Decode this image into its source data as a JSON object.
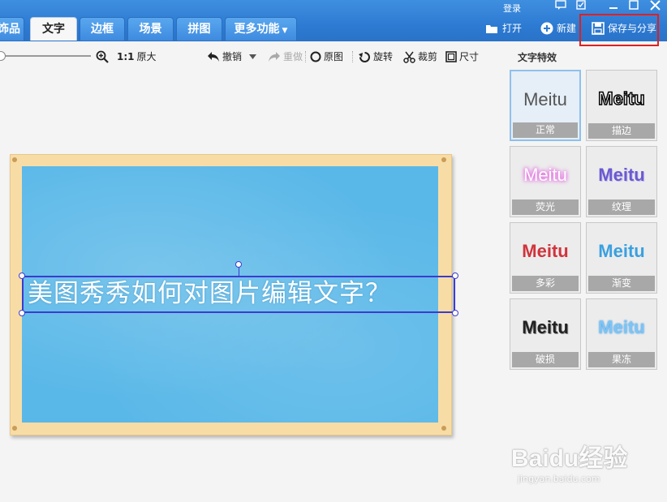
{
  "header": {
    "tabs": [
      {
        "label": "饰品"
      },
      {
        "label": "文字"
      },
      {
        "label": "边框"
      },
      {
        "label": "场景"
      },
      {
        "label": "拼图"
      },
      {
        "label": "更多功能"
      }
    ],
    "login_label": "登录",
    "open_label": "打开",
    "new_label": "新建",
    "save_label": "保存与分享"
  },
  "toolbar": {
    "zoom_ratio": "1:1",
    "original_size": "原大",
    "undo": "撤销",
    "redo": "重做",
    "original_image": "原图",
    "rotate": "旋转",
    "crop": "裁剪",
    "size": "尺寸"
  },
  "canvas": {
    "text": "美图秀秀如何对图片编辑文字？"
  },
  "panel": {
    "title": "文字特效",
    "effects": [
      {
        "sample": "Meitu",
        "label": "正常"
      },
      {
        "sample": "Meitu",
        "label": "描边"
      },
      {
        "sample": "Meitu",
        "label": "荧光"
      },
      {
        "sample": "Meitu",
        "label": "纹理"
      },
      {
        "sample": "Meitu",
        "label": "多彩"
      },
      {
        "sample": "Meitu",
        "label": "渐变"
      },
      {
        "sample": "Meitu",
        "label": "破损"
      },
      {
        "sample": "Meitu",
        "label": "果冻"
      }
    ]
  },
  "watermark": {
    "brand": "Baidu经验",
    "url": "jingyan.baidu.com"
  },
  "colors": {
    "accent": "#2d7bd3",
    "highlight": "#e02020",
    "board": "#5ab8e8",
    "frame": "#f8dca6"
  }
}
